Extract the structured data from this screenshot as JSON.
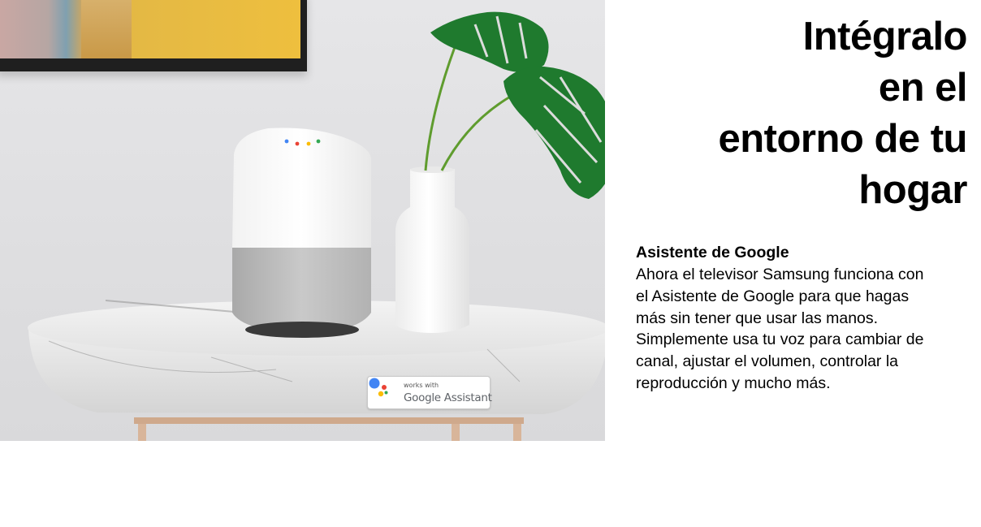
{
  "promo": {
    "headline_lines": [
      "Intégralo",
      "en el",
      "entorno de tu",
      "hogar"
    ],
    "feature_title": "Asistente de Google",
    "feature_body_lines": [
      "Ahora el televisor Samsung funciona con",
      "el Asistente de Google para que hagas",
      "más sin tener que usar las manos.",
      "Simplemente usa tu voz para cambiar de",
      "canal, ajustar el volumen, controlar la",
      "reproducción y mucho más."
    ]
  },
  "badge": {
    "small_text": "works with",
    "big_text": "Google Assistant"
  },
  "colors": {
    "google_blue": "#4285F4",
    "google_red": "#EA4335",
    "google_yellow": "#FBBC05",
    "google_green": "#34A853",
    "plant_green": "#1f7a2e"
  }
}
